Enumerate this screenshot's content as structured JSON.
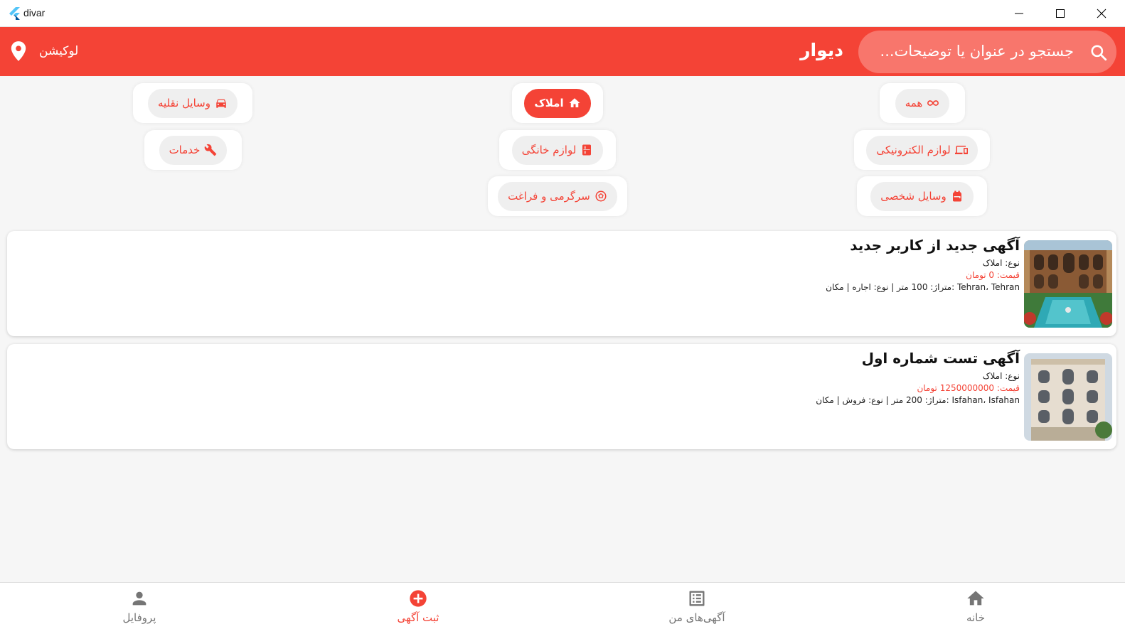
{
  "window": {
    "title": "divar"
  },
  "appbar": {
    "search_placeholder": "جستجو در عنوان یا توضیحات...",
    "brand": "دیوار",
    "location_label": "لوکیشن",
    "color": "#f44336"
  },
  "categories": [
    {
      "label": "همه",
      "icon": "infinity-icon",
      "active": false
    },
    {
      "label": "املاک",
      "icon": "home-icon",
      "active": true
    },
    {
      "label": "وسایل نقلیه",
      "icon": "car-icon",
      "active": false
    },
    {
      "label": "لوازم الکترونیکی",
      "icon": "devices-icon",
      "active": false
    },
    {
      "label": "لوازم خانگی",
      "icon": "kitchen-icon",
      "active": false
    },
    {
      "label": "خدمات",
      "icon": "wrench-icon",
      "active": false
    },
    {
      "label": "وسایل شخصی",
      "icon": "backpack-icon",
      "active": false
    },
    {
      "label": "سرگرمی و فراغت",
      "icon": "soccer-ball-icon",
      "active": false
    }
  ],
  "listings": [
    {
      "title": "آگهی جدید از کاربر جدید",
      "type": "نوع: املاک",
      "price": "قیمت: 0 تومان",
      "meta": "Tehran، Tehran :متراژ: 100 متر | نوع: اجاره | مکان"
    },
    {
      "title": "آگهی تست شماره اول",
      "type": "نوع: املاک",
      "price": "قیمت: 1250000000 تومان",
      "meta": "Isfahan، Isfahan :متراژ: 200 متر | نوع: فروش | مکان"
    }
  ],
  "bottom_nav": [
    {
      "label": "خانه",
      "icon": "home-icon",
      "active": false
    },
    {
      "label": "آگهی‌های من",
      "icon": "list-alt-icon",
      "active": false
    },
    {
      "label": "ثبت آگهی",
      "icon": "add-circle-icon",
      "active": true
    },
    {
      "label": "پروفایل",
      "icon": "person-icon",
      "active": false
    }
  ]
}
